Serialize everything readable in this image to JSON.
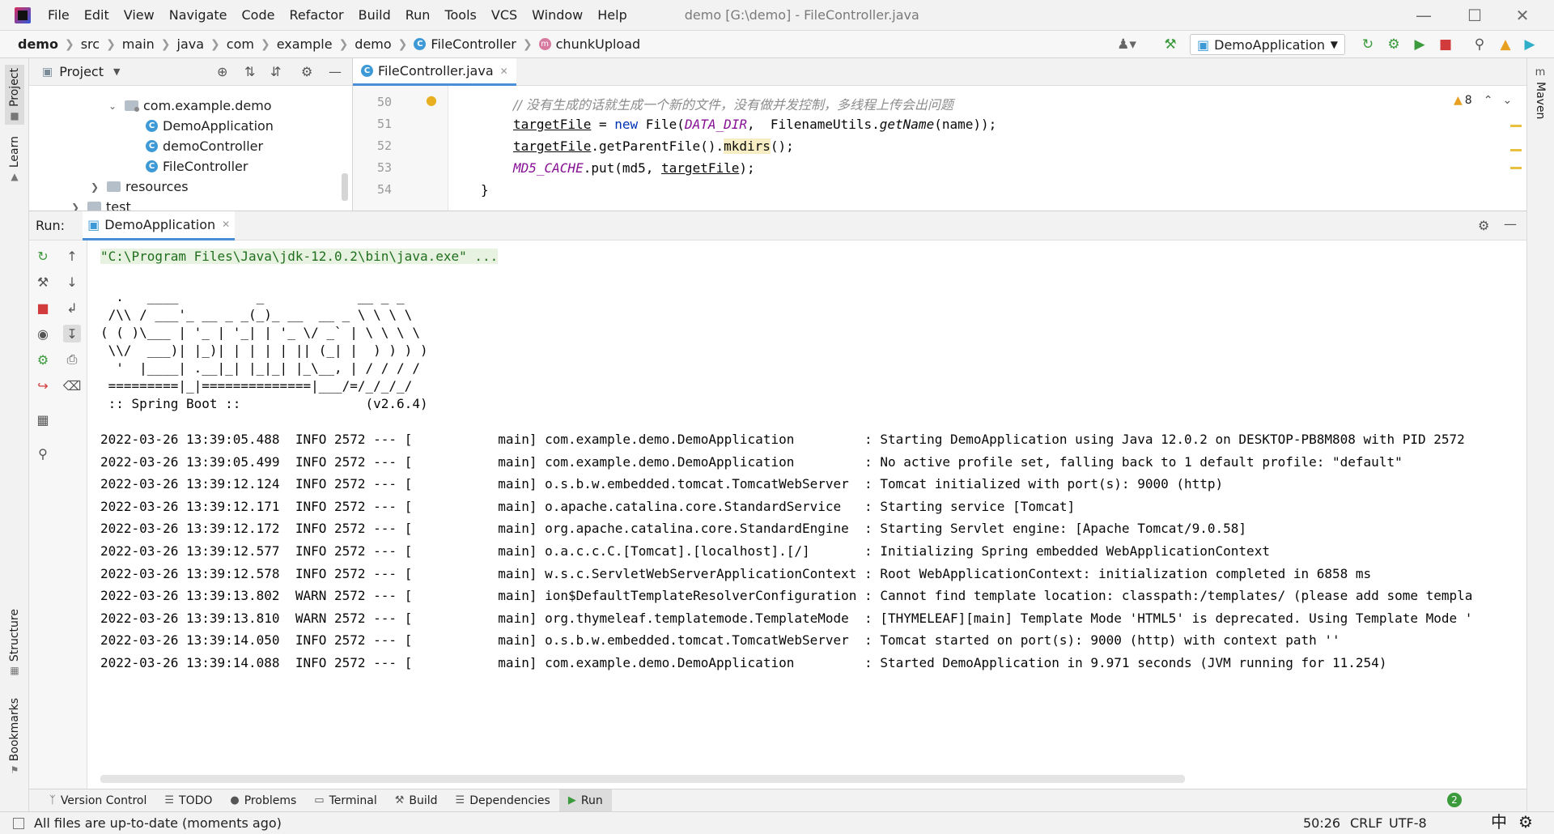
{
  "menu": [
    "File",
    "Edit",
    "View",
    "Navigate",
    "Code",
    "Refactor",
    "Build",
    "Run",
    "Tools",
    "VCS",
    "Window",
    "Help"
  ],
  "window_title": "demo [G:\\demo] - FileController.java",
  "breadcrumb": [
    "demo",
    "src",
    "main",
    "java",
    "com",
    "example",
    "demo",
    "FileController",
    "chunkUpload"
  ],
  "run_config": "DemoApplication",
  "project_panel": {
    "title": "Project",
    "tree": [
      {
        "label": "com.example.demo"
      },
      {
        "label": "DemoApplication"
      },
      {
        "label": "demoController"
      },
      {
        "label": "FileController"
      },
      {
        "label": "resources"
      },
      {
        "label": "test"
      }
    ]
  },
  "editor": {
    "tab": "FileController.java",
    "warning_count": "8",
    "line_numbers": [
      "50",
      "51",
      "52",
      "53",
      "54"
    ],
    "comment_line": "// 没有生成的话就生成一个新的文件，没有做并发控制，多线程上传会出问题"
  },
  "run_panel": {
    "label": "Run:",
    "tab": "DemoApplication",
    "command": "\"C:\\Program Files\\Java\\jdk-12.0.2\\bin\\java.exe\" ...",
    "banner": [
      "  .   ____          _            __ _ _",
      " /\\\\ / ___'_ __ _ _(_)_ __  __ _ \\ \\ \\ \\",
      "( ( )\\___ | '_ | '_| | '_ \\/ _` | \\ \\ \\ \\",
      " \\\\/  ___)| |_)| | | | | || (_| |  ) ) ) )",
      "  '  |____| .__|_| |_|_| |_\\__, | / / / /",
      " =========|_|==============|___/=/_/_/_/",
      " :: Spring Boot ::                (v2.6.4)"
    ],
    "log": [
      {
        "time": "2022-03-26 13:39:05.488",
        "level": "INFO",
        "pid": "2572",
        "thread": "main",
        "logger": "com.example.demo.DemoApplication        ",
        "msg": "Starting DemoApplication using Java 12.0.2 on DESKTOP-PB8M808 with PID 2572"
      },
      {
        "time": "2022-03-26 13:39:05.499",
        "level": "INFO",
        "pid": "2572",
        "thread": "main",
        "logger": "com.example.demo.DemoApplication        ",
        "msg": "No active profile set, falling back to 1 default profile: \"default\""
      },
      {
        "time": "2022-03-26 13:39:12.124",
        "level": "INFO",
        "pid": "2572",
        "thread": "main",
        "logger": "o.s.b.w.embedded.tomcat.TomcatWebServer ",
        "msg": "Tomcat initialized with port(s): 9000 (http)"
      },
      {
        "time": "2022-03-26 13:39:12.171",
        "level": "INFO",
        "pid": "2572",
        "thread": "main",
        "logger": "o.apache.catalina.core.StandardService  ",
        "msg": "Starting service [Tomcat]"
      },
      {
        "time": "2022-03-26 13:39:12.172",
        "level": "INFO",
        "pid": "2572",
        "thread": "main",
        "logger": "org.apache.catalina.core.StandardEngine ",
        "msg": "Starting Servlet engine: [Apache Tomcat/9.0.58]"
      },
      {
        "time": "2022-03-26 13:39:12.577",
        "level": "INFO",
        "pid": "2572",
        "thread": "main",
        "logger": "o.a.c.c.C.[Tomcat].[localhost].[/]      ",
        "msg": "Initializing Spring embedded WebApplicationContext"
      },
      {
        "time": "2022-03-26 13:39:12.578",
        "level": "INFO",
        "pid": "2572",
        "thread": "main",
        "logger": "w.s.c.ServletWebServerApplicationContext",
        "msg": "Root WebApplicationContext: initialization completed in 6858 ms"
      },
      {
        "time": "2022-03-26 13:39:13.802",
        "level": "WARN",
        "pid": "2572",
        "thread": "main",
        "logger": "ion$DefaultTemplateResolverConfiguration",
        "msg": "Cannot find template location: classpath:/templates/ (please add some templa"
      },
      {
        "time": "2022-03-26 13:39:13.810",
        "level": "WARN",
        "pid": "2572",
        "thread": "main",
        "logger": "org.thymeleaf.templatemode.TemplateMode ",
        "msg": "[THYMELEAF][main] Template Mode 'HTML5' is deprecated. Using Template Mode '"
      },
      {
        "time": "2022-03-26 13:39:14.050",
        "level": "INFO",
        "pid": "2572",
        "thread": "main",
        "logger": "o.s.b.w.embedded.tomcat.TomcatWebServer ",
        "msg": "Tomcat started on port(s): 9000 (http) with context path ''"
      },
      {
        "time": "2022-03-26 13:39:14.088",
        "level": "INFO",
        "pid": "2572",
        "thread": "main",
        "logger": "com.example.demo.DemoApplication        ",
        "msg": "Started DemoApplication in 9.971 seconds (JVM running for 11.254)"
      }
    ]
  },
  "left_stripe": {
    "project": "Project",
    "learn": "Learn",
    "structure": "Structure",
    "bookmarks": "Bookmarks"
  },
  "right_stripe": {
    "maven": "Maven"
  },
  "bottom_tabs": [
    "Version Control",
    "TODO",
    "Problems",
    "Terminal",
    "Build",
    "Dependencies",
    "Run"
  ],
  "status": {
    "message": "All files are up-to-date (moments ago)",
    "position": "50:26",
    "line_sep": "CRLF",
    "encoding": "UTF-8",
    "ime": "中",
    "events": "2"
  },
  "colors": {
    "accent": "#4a8ed8",
    "run_green": "#1f6f1f",
    "stop_red": "#d23b3b",
    "const_purple": "#871094",
    "keyword_blue": "#0033b3"
  }
}
